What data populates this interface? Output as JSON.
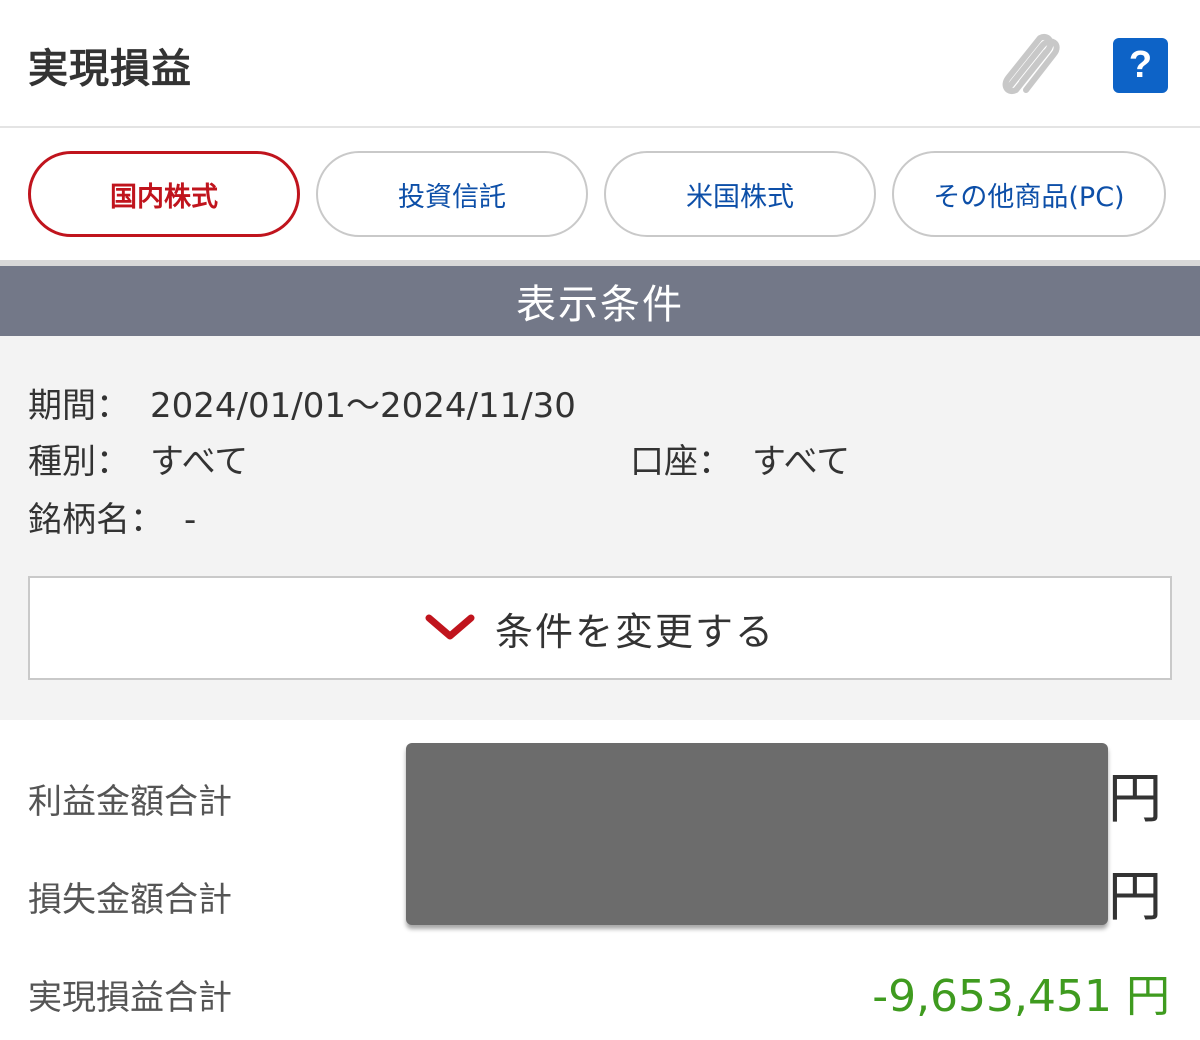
{
  "header": {
    "title": "実現損益",
    "help_label": "?"
  },
  "tabs": [
    {
      "label": "国内株式",
      "active": true
    },
    {
      "label": "投資信託",
      "active": false
    },
    {
      "label": "米国株式",
      "active": false
    },
    {
      "label": "その他商品(PC)",
      "active": false
    }
  ],
  "conditions": {
    "section_title": "表示条件",
    "period_label": "期間：",
    "period_value": "2024/01/01～2024/11/30",
    "type_label": "種別：",
    "type_value": "すべて",
    "account_label": "口座：",
    "account_value": "すべて",
    "stock_name_label": "銘柄名：",
    "stock_name_value": "-",
    "change_button_label": "条件を変更する"
  },
  "summary": {
    "profit_label": "利益金額合計",
    "profit_unit": "円",
    "loss_label": "損失金額合計",
    "loss_unit": "円",
    "realized_label": "実現損益合計",
    "realized_value": "-9,653,451 円"
  },
  "colors": {
    "brand_red": "#c0141d",
    "link_blue": "#0d4fa8",
    "help_blue": "#0d63c7",
    "section_gray": "#737888",
    "total_green": "#3f9b1f"
  }
}
